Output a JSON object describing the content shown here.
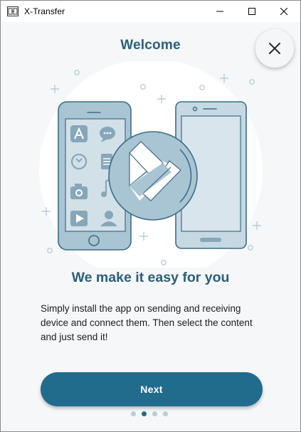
{
  "window": {
    "title": "X-Transfer",
    "icon": "app-logo-icon",
    "controls": [
      "minimize-icon",
      "maximize-icon",
      "close-icon"
    ]
  },
  "welcome": {
    "heading": "Welcome",
    "close_icon": "close-icon",
    "subheading": "We make it easy for you",
    "description": "Simply install the app on sending and receiving device and connect them. Then select the content and just send it!",
    "next_label": "Next"
  },
  "pager": {
    "count": 4,
    "active_index": 1
  },
  "colors": {
    "accent": "#216b8c",
    "heading": "#2b5f7a",
    "background": "#f5f7f8",
    "illustration_fill": "#a9c4d3",
    "illustration_stroke": "#3b6d87"
  }
}
